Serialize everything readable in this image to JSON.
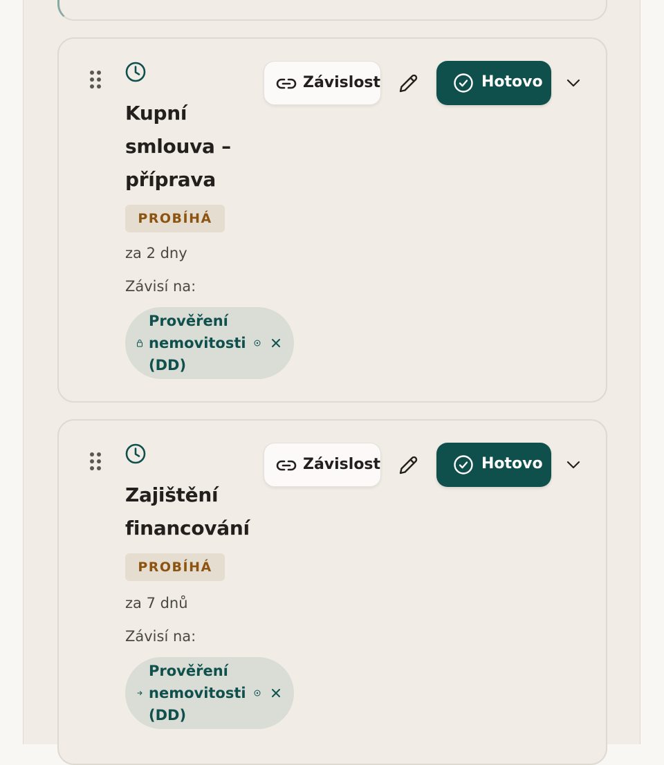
{
  "tasks": [
    {
      "title": "Kupní smlouva – příprava",
      "status": "PROBÍHÁ",
      "due": "za 2 dny",
      "depends_label": "Závisí na:",
      "dependency": "Prověření nemovitosti (DD)",
      "dependency_icon": "lock-icon",
      "actions": {
        "dependency": "Závislost",
        "done": "Hotovo"
      }
    },
    {
      "title": "Zajištění financování",
      "status": "PROBÍHÁ",
      "due": "za 7 dnů",
      "depends_label": "Závisí na:",
      "dependency": "Prověření nemovitosti (DD)",
      "dependency_icon": "arrow-right-icon",
      "actions": {
        "dependency": "Závislost",
        "done": "Hotovo"
      }
    }
  ],
  "colors": {
    "accent": "#0f504d",
    "status_text": "#8c5410",
    "status_bg": "#e5ddd0",
    "chip_bg": "#d9ddd6",
    "card_bg": "#f1ede6"
  }
}
